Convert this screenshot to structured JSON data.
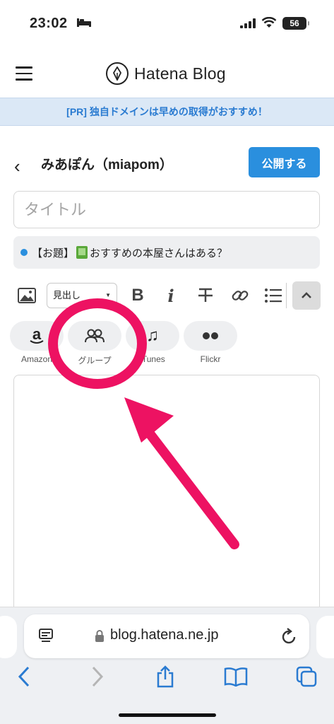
{
  "status": {
    "time": "23:02",
    "battery": "56"
  },
  "header": {
    "brand": "Hatena Blog"
  },
  "banner": {
    "text": "[PR] 独自ドメインは早めの取得がおすすめ！"
  },
  "editor": {
    "blog_name": "みあぽん（miapom）",
    "publish_label": "公開する",
    "title_placeholder": "タイトル",
    "topic_prefix": "【お題】",
    "topic_text": "おすすめの本屋さんはある？",
    "heading_select": "見出し"
  },
  "services": [
    {
      "label": "Amazon",
      "icon": "amazon-icon"
    },
    {
      "label": "グループ",
      "icon": "group-icon"
    },
    {
      "label": "iTunes",
      "icon": "music-icon"
    },
    {
      "label": "Flickr",
      "icon": "flickr-icon"
    }
  ],
  "browser": {
    "url": "blog.hatena.ne.jp"
  },
  "colors": {
    "accent": "#2a8fde",
    "highlight": "#ed1262",
    "banner_bg": "#dbe8f6"
  }
}
